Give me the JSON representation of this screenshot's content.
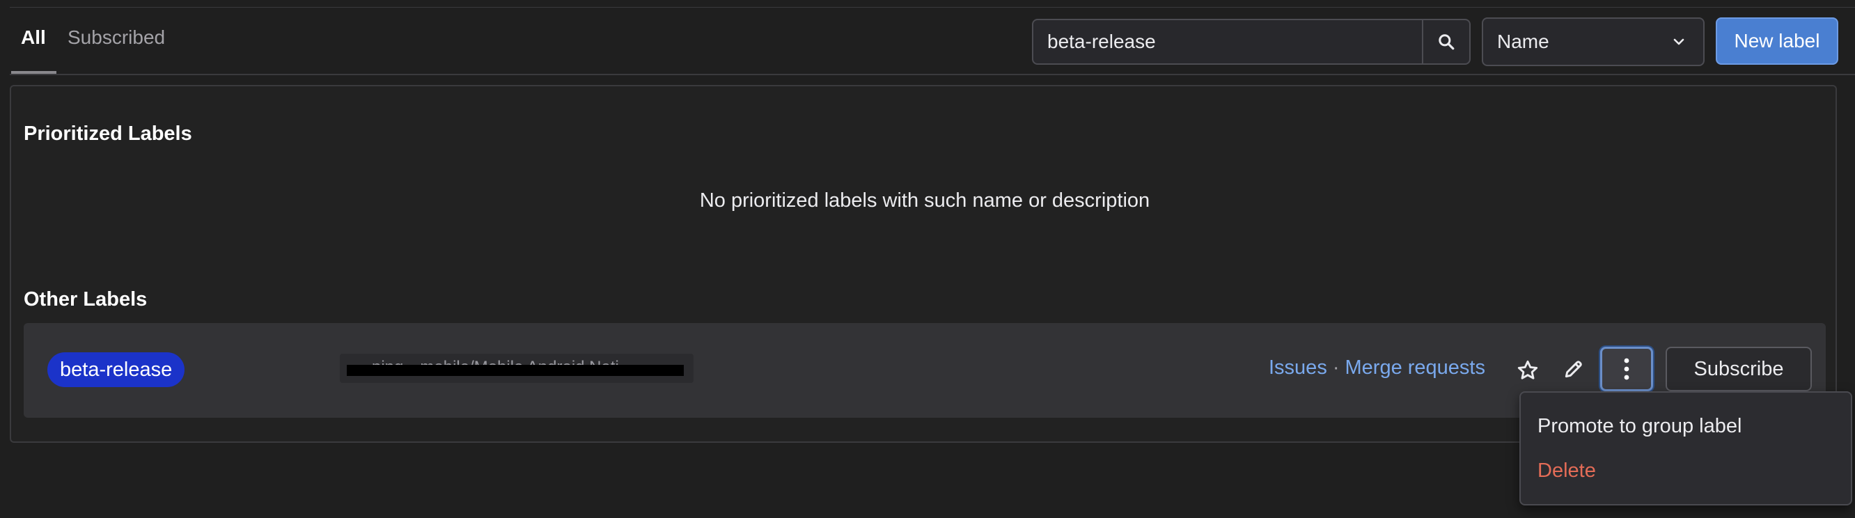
{
  "tabs": {
    "all": "All",
    "subscribed": "Subscribed"
  },
  "search": {
    "value": "beta-release",
    "icon": "search-icon"
  },
  "sort": {
    "selected": "Name"
  },
  "toolbar": {
    "new_label": "New label"
  },
  "prioritized": {
    "title": "Prioritized Labels",
    "empty_message": "No prioritized labels with such name or description"
  },
  "other": {
    "title": "Other Labels",
    "labels": [
      {
        "name": "beta-release",
        "color": "#1b33c9",
        "description_redacted": "…ping…mobile/Mobile Android Nati…",
        "issues_link": "Issues",
        "separator": "·",
        "mr_link": "Merge requests",
        "subscribe_label": "Subscribe"
      }
    ]
  },
  "menu": {
    "promote": "Promote to group label",
    "delete": "Delete"
  },
  "colors": {
    "accent": "#4a7fd1",
    "link": "#7aa9ed",
    "danger": "#e46c57",
    "label": "#1b33c9"
  }
}
